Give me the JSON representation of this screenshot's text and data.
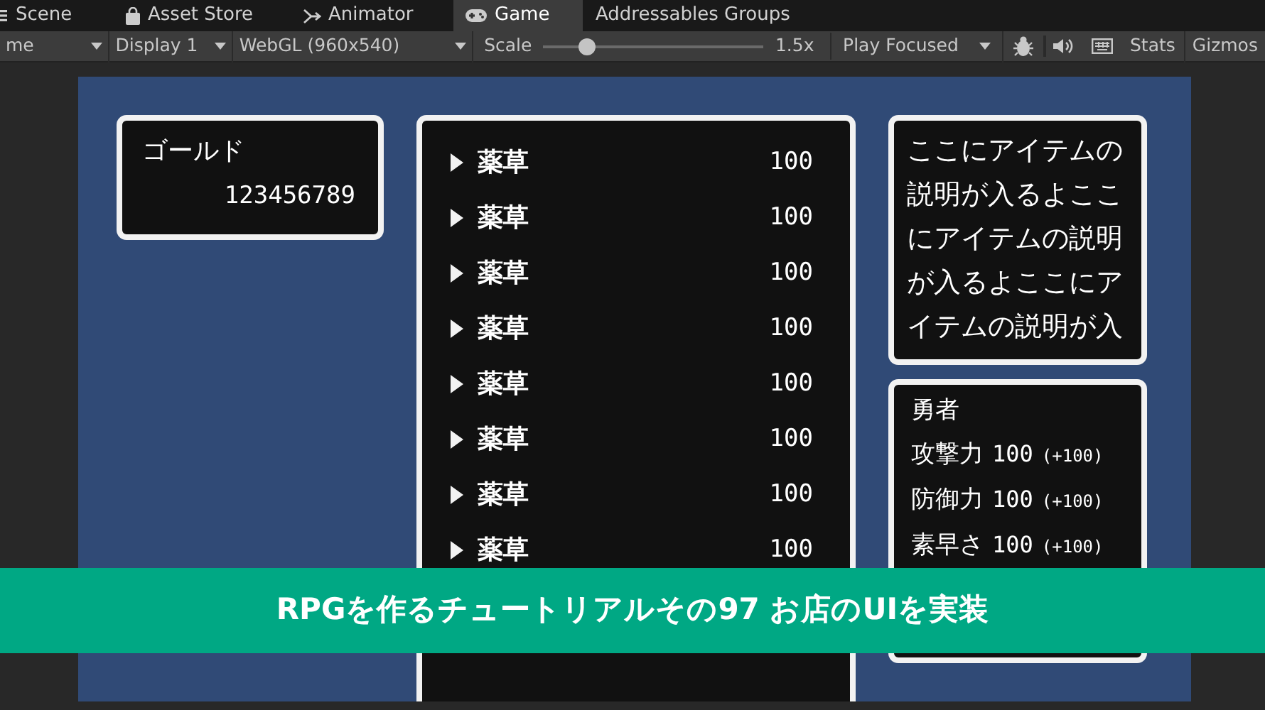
{
  "tabs": [
    {
      "label": "Scene",
      "kind": "scene",
      "selected": false
    },
    {
      "label": "Asset Store",
      "kind": "store",
      "selected": false
    },
    {
      "label": "Animator",
      "kind": "animator",
      "selected": false
    },
    {
      "label": "Game",
      "kind": "game",
      "selected": true
    },
    {
      "label": "Addressables Groups",
      "kind": "none",
      "selected": false
    }
  ],
  "toolbar": {
    "display_mode": "me",
    "display": "Display 1",
    "resolution": "WebGL (960x540)",
    "scale_label": "Scale",
    "scale": {
      "level": 0.2
    },
    "scale_reading": "1.5x",
    "play_mode": "Play Focused",
    "stats": "Stats",
    "gizmos": "Gizmos"
  },
  "game": {
    "gold": {
      "label": "ゴールド",
      "amount": "123456789"
    },
    "items": [
      {
        "name": "薬草",
        "price": "100"
      },
      {
        "name": "薬草",
        "price": "100"
      },
      {
        "name": "薬草",
        "price": "100"
      },
      {
        "name": "薬草",
        "price": "100"
      },
      {
        "name": "薬草",
        "price": "100"
      },
      {
        "name": "薬草",
        "price": "100"
      },
      {
        "name": "薬草",
        "price": "100"
      },
      {
        "name": "薬草",
        "price": "100"
      }
    ],
    "description": "ここにアイテムの説明が入るよここにアイテムの説明が入るよここにアイテムの説明が入",
    "status": {
      "name": "勇者",
      "stats": [
        {
          "label": "攻撃力",
          "value": "100",
          "bonus": "(+100)"
        },
        {
          "label": "防御力",
          "value": "100",
          "bonus": "(+100)"
        },
        {
          "label": "素早さ",
          "value": "100",
          "bonus": "(+100)"
        }
      ]
    }
  },
  "banner": {
    "title": "RPGを作るチュートリアルその97 お店のUIを実装"
  }
}
